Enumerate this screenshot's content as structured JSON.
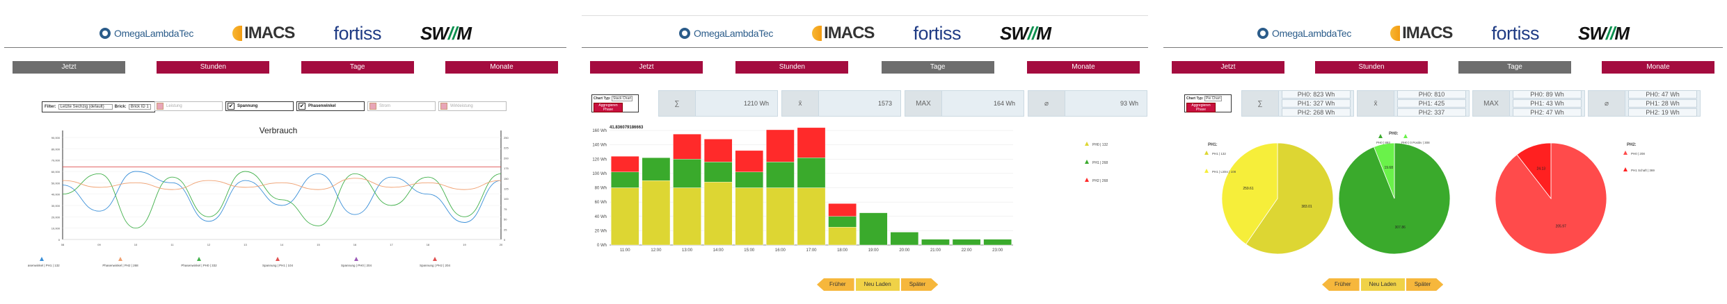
{
  "logos": {
    "omega": "OmegaLambdaTec",
    "imacs": "IMACS",
    "fortiss": "fortiss",
    "swm_a": "SW",
    "swm_b": "//",
    "swm_c": "M"
  },
  "colors": {
    "tab": "#a40c3f",
    "tab_selected": "#6d6d6d",
    "ph0": "#ddd633",
    "ph1": "#3aaa2c",
    "ph2": "#ff2a2a"
  },
  "tabs": [
    "Jetzt",
    "Stunden",
    "Tage",
    "Monate"
  ],
  "panel1": {
    "filter_label": "Filter:",
    "filter_value": "Letzte Sechzig (default)",
    "brick_label": "Brick:",
    "brick_value": "Brick ID 1",
    "legend_checks": [
      {
        "label": "Leistung",
        "checked": false
      },
      {
        "label": "Spannung",
        "checked": true
      },
      {
        "label": "Phasenwinkel",
        "checked": true
      },
      {
        "label": "Strom",
        "checked": false
      },
      {
        "label": "Wirkleistung",
        "checked": false
      }
    ],
    "chart_title": "Verbrauch",
    "legend_markers": [
      "Phasenwinkel | PH1 | 132",
      "Phasenwinkel | PH2 | 268",
      "Phasenwinkel | PH0 | 332",
      "Spannung | PH1 | 104",
      "Spannung | PH0 | 204",
      "Spannung | PH2 | 204"
    ]
  },
  "panel2": {
    "chart_type_label": "Chart Typ:",
    "chart_type_value": "Stack Chart",
    "aggregate_btn": "Aggregieren Phase",
    "stats": [
      {
        "sym": "∑",
        "val": "1210 Wh"
      },
      {
        "sym": "x̄",
        "val": "1573"
      },
      {
        "sym": "MAX",
        "val": "164 Wh"
      },
      {
        "sym": "⌀",
        "val": "93 Wh"
      }
    ],
    "tooltip": "41.836079186663",
    "legend": [
      "PH0 | 132",
      "PH1 | 268",
      "PH2 | 268"
    ]
  },
  "panel3": {
    "chart_type_label": "Chart Typ:",
    "chart_type_value": "Pie Chart",
    "aggregate_btn": "Aggregieren Phase",
    "stats": [
      {
        "sym": "∑",
        "vals": [
          "PH0: 823 Wh",
          "PH1: 327 Wh",
          "PH2: 268 Wh"
        ]
      },
      {
        "sym": "x̄",
        "vals": [
          "PH0: 810",
          "PH1: 425",
          "PH2: 337"
        ]
      },
      {
        "sym": "MAX",
        "vals": [
          "PH0: 89 Wh",
          "PH1: 43 Wh",
          "PH2: 47 Wh"
        ]
      },
      {
        "sym": "⌀",
        "vals": [
          "PH0: 47 Wh",
          "PH1: 28 Wh",
          "PH2: 19 Wh"
        ]
      }
    ],
    "pie_titles": [
      "PH1:",
      "PH0:",
      "PH2:"
    ],
    "pie1_legend": [
      "PH1 | 132",
      "PH1 | Links | 108"
    ],
    "pie2_legend": [
      "PH0 | 893",
      "PH0 | 0 Positiv | 308"
    ],
    "pie3_legend": [
      "PH0 | 208",
      "PH1 Schaft | 369"
    ]
  },
  "nav": {
    "prev": "Früher",
    "reload": "Neu Laden",
    "next": "Später"
  },
  "chart_data": [
    {
      "type": "line",
      "title": "Verbrauch",
      "x": [
        "08",
        "09",
        "10",
        "11",
        "12",
        "13",
        "14",
        "15",
        "16",
        "17",
        "18",
        "19",
        "20"
      ],
      "ylim": [
        0,
        90000
      ],
      "yticks": [
        "0",
        "10,000",
        "20,000",
        "30,000",
        "40,000",
        "50,000",
        "60,000",
        "70,000",
        "80,000",
        "90,000"
      ],
      "y2ticks": [
        "0",
        "25",
        "50",
        "75",
        "100",
        "125",
        "150",
        "175",
        "200",
        "225",
        "250"
      ],
      "series": [
        {
          "name": "Phasenwinkel | PH1 | 132",
          "values": [
            48000,
            25000,
            60000,
            50000,
            16000,
            52000,
            30000,
            58000,
            22000,
            55000,
            40000,
            15000,
            52000
          ]
        },
        {
          "name": "Phasenwinkel | PH0 | 332",
          "values": [
            40000,
            58000,
            10000,
            55000,
            20000,
            60000,
            35000,
            12000,
            58000,
            30000,
            55000,
            20000,
            58000
          ]
        },
        {
          "name": "Phasenwinkel | PH2 | 268",
          "values": [
            52000,
            46000,
            50000,
            44000,
            52000,
            46000,
            50000,
            44000,
            54000,
            46000,
            50000,
            44000,
            52000
          ]
        },
        {
          "name": "Spannung | PH1 | 104",
          "values": [
            64000,
            64000,
            64000,
            64000,
            64000,
            64000,
            64000,
            64000,
            64000,
            64000,
            64000,
            64000,
            64000
          ]
        }
      ]
    },
    {
      "type": "bar",
      "categories": [
        "11:00",
        "12:00",
        "13:00",
        "14:00",
        "15:00",
        "16:00",
        "17:00",
        "18:00",
        "19:00",
        "20:00",
        "21:00",
        "22:00",
        "23:00"
      ],
      "ylim": [
        0,
        160
      ],
      "yticks": [
        "0 Wh",
        "20 Wh",
        "40 Wh",
        "60 Wh",
        "80 Wh",
        "100 Wh",
        "120 Wh",
        "140 Wh",
        "160 Wh"
      ],
      "series": [
        {
          "name": "PH0 | 132",
          "values": [
            80,
            90,
            80,
            88,
            80,
            80,
            80,
            25,
            0,
            0,
            0,
            0,
            0
          ]
        },
        {
          "name": "PH1 | 268",
          "values": [
            22,
            32,
            40,
            28,
            22,
            36,
            42,
            15,
            45,
            18,
            8,
            8,
            8
          ]
        },
        {
          "name": "PH2 | 268",
          "values": [
            22,
            0,
            35,
            32,
            30,
            45,
            42,
            18,
            0,
            0,
            0,
            0,
            0
          ]
        }
      ]
    },
    {
      "type": "pie",
      "series": [
        {
          "name": "PH1:",
          "values": [
            383.01,
            259.61
          ]
        },
        {
          "name": "PH0:",
          "values": [
            307.86,
            19.68
          ]
        },
        {
          "name": "PH2:",
          "values": [
            205.97,
            24.13
          ]
        }
      ]
    }
  ]
}
